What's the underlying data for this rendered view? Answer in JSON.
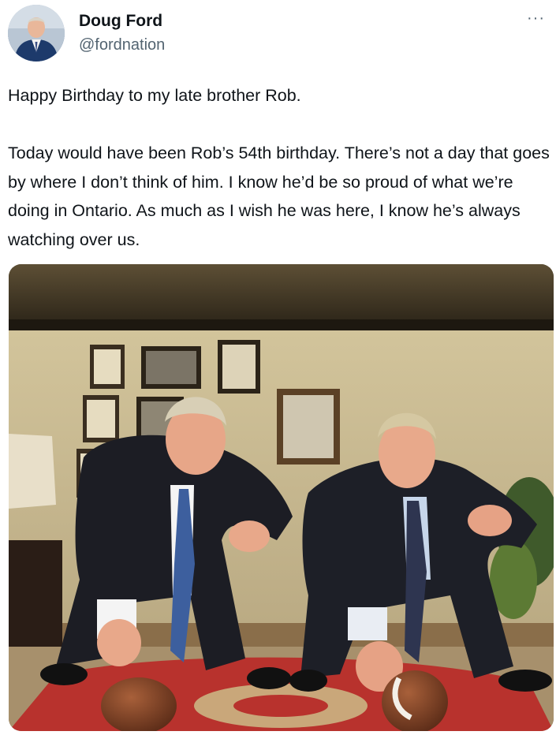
{
  "author": {
    "display_name": "Doug Ford",
    "handle": "@fordnation",
    "avatar_icon": "profile-photo"
  },
  "menu": {
    "more_label": "···"
  },
  "tweet": {
    "text": "Happy Birthday to my late brother Rob.\n\nToday would have been Rob’s 54th birthday. There’s not a day that goes by where I don’t think of him. I know he’d be so proud of what we’re doing in Ontario. As much as I wish he was here, I know he’s always watching over us."
  },
  "media": {
    "type": "photo",
    "colors": {
      "wall": "#c9b98e",
      "ceiling": "#2c2416",
      "carpet": "#b8322d",
      "suit": "#1c1d24",
      "tie_left": "#3d5f9e",
      "tie_right": "#2e3550"
    }
  }
}
